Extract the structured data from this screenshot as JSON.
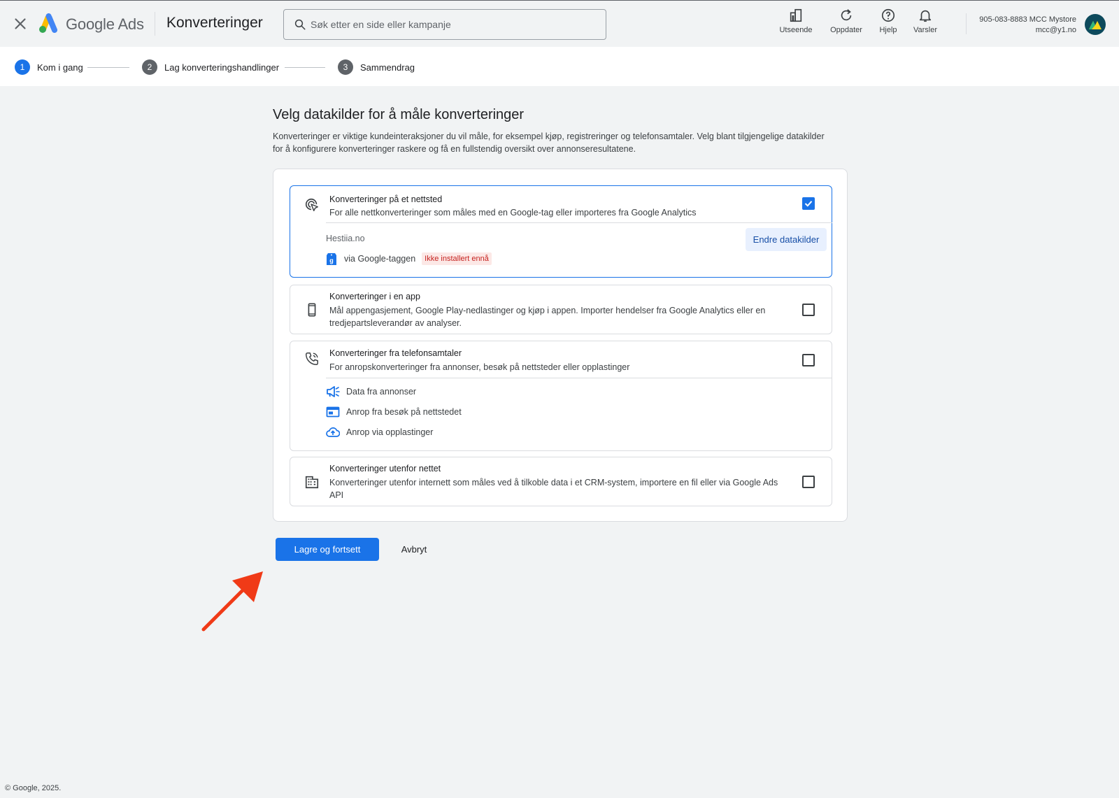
{
  "header": {
    "brand": "Google Ads",
    "page_title": "Konverteringer",
    "search_placeholder": "Søk etter en side eller kampanje",
    "tools": {
      "appearance": "Utseende",
      "refresh": "Oppdater",
      "help": "Hjelp",
      "notifications": "Varsler"
    },
    "account": {
      "id_name": "905-083-8883 MCC Mystore",
      "email": "mcc@y1.no"
    }
  },
  "stepper": {
    "steps": [
      {
        "num": "1",
        "label": "Kom i gang"
      },
      {
        "num": "2",
        "label": "Lag konverteringshandlinger"
      },
      {
        "num": "3",
        "label": "Sammendrag"
      }
    ]
  },
  "main": {
    "title": "Velg datakilder for å måle konverteringer",
    "description": "Konverteringer er viktige kundeinteraksjoner du vil måle, for eksempel kjøp, registreringer og telefonsamtaler. Velg blant tilgjengelige datakilder for å konfigurere konverteringer raskere og få en fullstendig oversikt over annonseresultatene."
  },
  "cards": {
    "web": {
      "title": "Konverteringer på et nettsted",
      "desc": "For alle nettkonverteringer som måles med en Google-tag eller importeres fra Google Analytics",
      "checked": true,
      "site": "Hestiia.no",
      "via": "via Google-taggen",
      "badge": "Ikke installert ennå",
      "change_button": "Endre datakilder"
    },
    "app": {
      "title": "Konverteringer i en app",
      "desc": "Mål appengasjement, Google Play-nedlastinger og kjøp i appen. Importer hendelser fra Google Analytics eller en tredjepartsleverandør av analyser.",
      "checked": false
    },
    "phone": {
      "title": "Konverteringer fra telefonsamtaler",
      "desc": "For anropskonverteringer fra annonser, besøk på nettsteder eller opplastinger",
      "checked": false,
      "sources": [
        "Data fra annonser",
        "Anrop fra besøk på nettstedet",
        "Anrop via opplastinger"
      ]
    },
    "offline": {
      "title": "Konverteringer utenfor nettet",
      "desc": "Konverteringer utenfor internett som måles ved å tilkoble data i et CRM-system, importere en fil eller via Google Ads API",
      "checked": false
    }
  },
  "actions": {
    "save": "Lagre og fortsett",
    "cancel": "Avbryt"
  },
  "footer": "© Google, 2025.",
  "colors": {
    "primary": "#1a73e8",
    "annotation_arrow": "#f03a17",
    "badge_bg": "#fce8e6",
    "badge_text": "#c5221f"
  }
}
